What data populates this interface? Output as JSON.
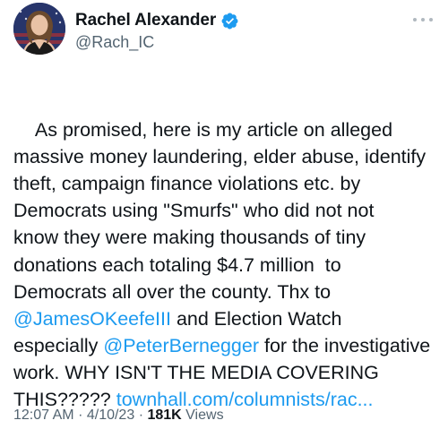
{
  "author": {
    "display_name": "Rachel Alexander",
    "handle": "@Rach_IC",
    "verified": true,
    "verified_color": "#1d9bf0"
  },
  "tweet": {
    "segments": [
      {
        "text": "As promised, here is my article on alleged\nmassive money laundering, elder abuse, identify\ntheft, campaign finance violations etc. by\nDemocrats using \"Smurfs\" who did not not\nknow they were making thousands of tiny\ndonations each totaling $4.7 million  to\nDemocrats all over the county. Thx to\n",
        "type": "text"
      },
      {
        "text": "@JamesOKeefeIII",
        "type": "link"
      },
      {
        "text": " and Election Watch\nespecially ",
        "type": "text"
      },
      {
        "text": "@PeterBernegger",
        "type": "link"
      },
      {
        "text": " for the investigative\nwork. WHY ISN'T THE MEDIA COVERING\nTHIS????? ",
        "type": "text"
      },
      {
        "text": "townhall.com/columnists/rac...",
        "type": "link"
      }
    ]
  },
  "meta": {
    "time": "12:07 AM",
    "separator": "·",
    "date": "4/10/23",
    "views_count": "181K",
    "views_label": "Views"
  },
  "icons": {
    "more": "more-horizontal-icon",
    "verified": "verified-badge-icon"
  },
  "colors": {
    "link": "#1d9bf0",
    "secondary_text": "#536471",
    "primary_text": "#0f1419"
  }
}
